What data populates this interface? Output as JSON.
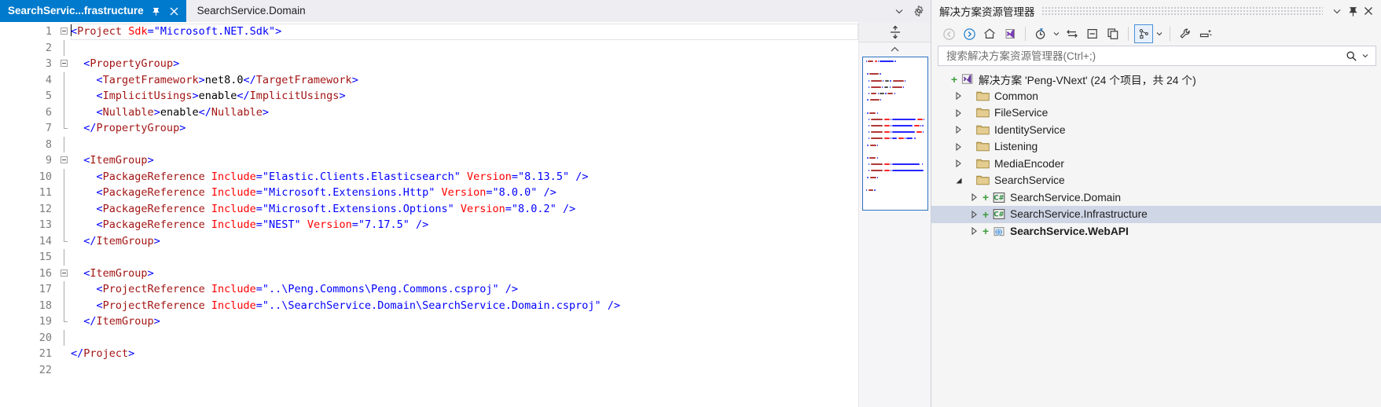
{
  "editor": {
    "tabs": [
      {
        "label": "SearchServic...frastructure",
        "active": true,
        "pin_icon": "pin-icon",
        "close_icon": "close-icon"
      },
      {
        "label": "SearchService.Domain",
        "active": false
      }
    ],
    "tabstrip_buttons": [
      {
        "name": "tab-list-dropdown",
        "icon": "chevron-down-icon"
      },
      {
        "name": "tab-settings",
        "icon": "gear-icon"
      }
    ],
    "split_button_icon": "split-view-icon",
    "scroll_up_icon": "chevron-up-icon",
    "line_numbers": [
      1,
      2,
      3,
      4,
      5,
      6,
      7,
      8,
      9,
      10,
      11,
      12,
      13,
      14,
      15,
      16,
      17,
      18,
      19,
      20,
      21,
      22
    ],
    "lines": [
      [
        {
          "t": "brk",
          "s": "<"
        },
        {
          "t": "tag",
          "s": "Project"
        },
        {
          "t": "txt",
          "s": " "
        },
        {
          "t": "attr",
          "s": "Sdk"
        },
        {
          "t": "brk",
          "s": "="
        },
        {
          "t": "val",
          "s": "\"Microsoft.NET.Sdk\""
        },
        {
          "t": "brk",
          "s": ">"
        }
      ],
      [],
      [
        {
          "t": "txt",
          "s": "  "
        },
        {
          "t": "brk",
          "s": "<"
        },
        {
          "t": "tag",
          "s": "PropertyGroup"
        },
        {
          "t": "brk",
          "s": ">"
        }
      ],
      [
        {
          "t": "txt",
          "s": "    "
        },
        {
          "t": "brk",
          "s": "<"
        },
        {
          "t": "tag",
          "s": "TargetFramework"
        },
        {
          "t": "brk",
          "s": ">"
        },
        {
          "t": "txt",
          "s": "net8.0"
        },
        {
          "t": "brk",
          "s": "</"
        },
        {
          "t": "tag",
          "s": "TargetFramework"
        },
        {
          "t": "brk",
          "s": ">"
        }
      ],
      [
        {
          "t": "txt",
          "s": "    "
        },
        {
          "t": "brk",
          "s": "<"
        },
        {
          "t": "tag",
          "s": "ImplicitUsings"
        },
        {
          "t": "brk",
          "s": ">"
        },
        {
          "t": "txt",
          "s": "enable"
        },
        {
          "t": "brk",
          "s": "</"
        },
        {
          "t": "tag",
          "s": "ImplicitUsings"
        },
        {
          "t": "brk",
          "s": ">"
        }
      ],
      [
        {
          "t": "txt",
          "s": "    "
        },
        {
          "t": "brk",
          "s": "<"
        },
        {
          "t": "tag",
          "s": "Nullable"
        },
        {
          "t": "brk",
          "s": ">"
        },
        {
          "t": "txt",
          "s": "enable"
        },
        {
          "t": "brk",
          "s": "</"
        },
        {
          "t": "tag",
          "s": "Nullable"
        },
        {
          "t": "brk",
          "s": ">"
        }
      ],
      [
        {
          "t": "txt",
          "s": "  "
        },
        {
          "t": "brk",
          "s": "</"
        },
        {
          "t": "tag",
          "s": "PropertyGroup"
        },
        {
          "t": "brk",
          "s": ">"
        }
      ],
      [],
      [
        {
          "t": "txt",
          "s": "  "
        },
        {
          "t": "brk",
          "s": "<"
        },
        {
          "t": "tag",
          "s": "ItemGroup"
        },
        {
          "t": "brk",
          "s": ">"
        }
      ],
      [
        {
          "t": "txt",
          "s": "    "
        },
        {
          "t": "brk",
          "s": "<"
        },
        {
          "t": "tag",
          "s": "PackageReference"
        },
        {
          "t": "txt",
          "s": " "
        },
        {
          "t": "attr",
          "s": "Include"
        },
        {
          "t": "brk",
          "s": "="
        },
        {
          "t": "val",
          "s": "\"Elastic.Clients.Elasticsearch\""
        },
        {
          "t": "txt",
          "s": " "
        },
        {
          "t": "attr",
          "s": "Version"
        },
        {
          "t": "brk",
          "s": "="
        },
        {
          "t": "val",
          "s": "\"8.13.5\""
        },
        {
          "t": "txt",
          "s": " "
        },
        {
          "t": "brk",
          "s": "/>"
        }
      ],
      [
        {
          "t": "txt",
          "s": "    "
        },
        {
          "t": "brk",
          "s": "<"
        },
        {
          "t": "tag",
          "s": "PackageReference"
        },
        {
          "t": "txt",
          "s": " "
        },
        {
          "t": "attr",
          "s": "Include"
        },
        {
          "t": "brk",
          "s": "="
        },
        {
          "t": "val",
          "s": "\"Microsoft.Extensions.Http\""
        },
        {
          "t": "txt",
          "s": " "
        },
        {
          "t": "attr",
          "s": "Version"
        },
        {
          "t": "brk",
          "s": "="
        },
        {
          "t": "val",
          "s": "\"8.0.0\""
        },
        {
          "t": "txt",
          "s": " "
        },
        {
          "t": "brk",
          "s": "/>"
        }
      ],
      [
        {
          "t": "txt",
          "s": "    "
        },
        {
          "t": "brk",
          "s": "<"
        },
        {
          "t": "tag",
          "s": "PackageReference"
        },
        {
          "t": "txt",
          "s": " "
        },
        {
          "t": "attr",
          "s": "Include"
        },
        {
          "t": "brk",
          "s": "="
        },
        {
          "t": "val",
          "s": "\"Microsoft.Extensions.Options\""
        },
        {
          "t": "txt",
          "s": " "
        },
        {
          "t": "attr",
          "s": "Version"
        },
        {
          "t": "brk",
          "s": "="
        },
        {
          "t": "val",
          "s": "\"8.0.2\""
        },
        {
          "t": "txt",
          "s": " "
        },
        {
          "t": "brk",
          "s": "/>"
        }
      ],
      [
        {
          "t": "txt",
          "s": "    "
        },
        {
          "t": "brk",
          "s": "<"
        },
        {
          "t": "tag",
          "s": "PackageReference"
        },
        {
          "t": "txt",
          "s": " "
        },
        {
          "t": "attr",
          "s": "Include"
        },
        {
          "t": "brk",
          "s": "="
        },
        {
          "t": "val",
          "s": "\"NEST\""
        },
        {
          "t": "txt",
          "s": " "
        },
        {
          "t": "attr",
          "s": "Version"
        },
        {
          "t": "brk",
          "s": "="
        },
        {
          "t": "val",
          "s": "\"7.17.5\""
        },
        {
          "t": "txt",
          "s": " "
        },
        {
          "t": "brk",
          "s": "/>"
        }
      ],
      [
        {
          "t": "txt",
          "s": "  "
        },
        {
          "t": "brk",
          "s": "</"
        },
        {
          "t": "tag",
          "s": "ItemGroup"
        },
        {
          "t": "brk",
          "s": ">"
        }
      ],
      [],
      [
        {
          "t": "txt",
          "s": "  "
        },
        {
          "t": "brk",
          "s": "<"
        },
        {
          "t": "tag",
          "s": "ItemGroup"
        },
        {
          "t": "brk",
          "s": ">"
        }
      ],
      [
        {
          "t": "txt",
          "s": "    "
        },
        {
          "t": "brk",
          "s": "<"
        },
        {
          "t": "tag",
          "s": "ProjectReference"
        },
        {
          "t": "txt",
          "s": " "
        },
        {
          "t": "attr",
          "s": "Include"
        },
        {
          "t": "brk",
          "s": "="
        },
        {
          "t": "val",
          "s": "\"..\\Peng.Commons\\Peng.Commons.csproj\""
        },
        {
          "t": "txt",
          "s": " "
        },
        {
          "t": "brk",
          "s": "/>"
        }
      ],
      [
        {
          "t": "txt",
          "s": "    "
        },
        {
          "t": "brk",
          "s": "<"
        },
        {
          "t": "tag",
          "s": "ProjectReference"
        },
        {
          "t": "txt",
          "s": " "
        },
        {
          "t": "attr",
          "s": "Include"
        },
        {
          "t": "brk",
          "s": "="
        },
        {
          "t": "val",
          "s": "\"..\\SearchService.Domain\\SearchService.Domain.csproj\""
        },
        {
          "t": "txt",
          "s": " "
        },
        {
          "t": "brk",
          "s": "/>"
        }
      ],
      [
        {
          "t": "txt",
          "s": "  "
        },
        {
          "t": "brk",
          "s": "</"
        },
        {
          "t": "tag",
          "s": "ItemGroup"
        },
        {
          "t": "brk",
          "s": ">"
        }
      ],
      [],
      [
        {
          "t": "brk",
          "s": "</"
        },
        {
          "t": "tag",
          "s": "Project"
        },
        {
          "t": "brk",
          "s": ">"
        }
      ],
      []
    ]
  },
  "solution_explorer": {
    "title": "解决方案资源管理器",
    "header_buttons": [
      {
        "name": "dropdown-menu-button",
        "icon": "chevron-down-icon"
      },
      {
        "name": "pin-button",
        "icon": "pin-icon"
      },
      {
        "name": "close-button",
        "icon": "close-icon"
      }
    ],
    "toolbar": [
      {
        "name": "back-button",
        "icon": "arrow-left-circle-icon",
        "disabled": true
      },
      {
        "name": "forward-button",
        "icon": "arrow-right-circle-icon",
        "disabled": false
      },
      {
        "name": "home-button",
        "icon": "home-icon",
        "disabled": false
      },
      {
        "name": "solution-button",
        "icon": "visual-studio-icon",
        "disabled": false
      },
      {
        "name": "pending-changes-button",
        "icon": "clock-filter-icon",
        "disabled": false
      },
      {
        "name": "sync-with-active-document-button",
        "icon": "sync-arrows-icon",
        "disabled": false
      },
      {
        "name": "collapse-all-button",
        "icon": "collapse-all-icon",
        "disabled": false
      },
      {
        "name": "show-all-files-button",
        "icon": "copy-files-icon",
        "disabled": false
      },
      {
        "name": "view-options-button",
        "icon": "object-hierarchy-icon",
        "disabled": false,
        "boxed": true
      },
      {
        "name": "properties-button",
        "icon": "wrench-icon",
        "disabled": false
      },
      {
        "name": "preview-selected-items-button",
        "icon": "preview-icon",
        "disabled": false
      }
    ],
    "search": {
      "placeholder": "搜索解决方案资源管理器(Ctrl+;)",
      "value": "",
      "icon": "search-icon",
      "dropdown_icon": "chevron-down-icon"
    },
    "tree": [
      {
        "label": "解决方案 'Peng-VNext' (24 个项目，共 24 个)",
        "depth": 0,
        "twisty": "none",
        "plus": true,
        "icon": "solution-icon",
        "selected": false,
        "bold": false
      },
      {
        "label": "Common",
        "depth": 1,
        "twisty": "collapsed",
        "plus": false,
        "icon": "folder-icon",
        "selected": false,
        "bold": false
      },
      {
        "label": "FileService",
        "depth": 1,
        "twisty": "collapsed",
        "plus": false,
        "icon": "folder-icon",
        "selected": false,
        "bold": false
      },
      {
        "label": "IdentityService",
        "depth": 1,
        "twisty": "collapsed",
        "plus": false,
        "icon": "folder-icon",
        "selected": false,
        "bold": false
      },
      {
        "label": "Listening",
        "depth": 1,
        "twisty": "collapsed",
        "plus": false,
        "icon": "folder-icon",
        "selected": false,
        "bold": false
      },
      {
        "label": "MediaEncoder",
        "depth": 1,
        "twisty": "collapsed",
        "plus": false,
        "icon": "folder-icon",
        "selected": false,
        "bold": false
      },
      {
        "label": "SearchService",
        "depth": 1,
        "twisty": "expanded",
        "plus": false,
        "icon": "folder-icon",
        "selected": false,
        "bold": false
      },
      {
        "label": "SearchService.Domain",
        "depth": 2,
        "twisty": "collapsed",
        "plus": true,
        "icon": "csharp-project-icon",
        "selected": false,
        "bold": false
      },
      {
        "label": "SearchService.Infrastructure",
        "depth": 2,
        "twisty": "collapsed",
        "plus": true,
        "icon": "csharp-project-icon",
        "selected": true,
        "bold": false
      },
      {
        "label": "SearchService.WebAPI",
        "depth": 2,
        "twisty": "collapsed",
        "plus": true,
        "icon": "web-project-icon",
        "selected": false,
        "bold": true
      }
    ]
  },
  "colors": {
    "accent": "#007acc",
    "tab_inactive_bg": "#eeeef2",
    "selection_bg": "#cfd6e6",
    "xml_tag": "#a31515",
    "xml_bracket": "#0000ff",
    "xml_attr": "#ff0000",
    "xml_value": "#0000ff",
    "folder": "#c8a85a",
    "plus_green": "#3f9e3f"
  }
}
